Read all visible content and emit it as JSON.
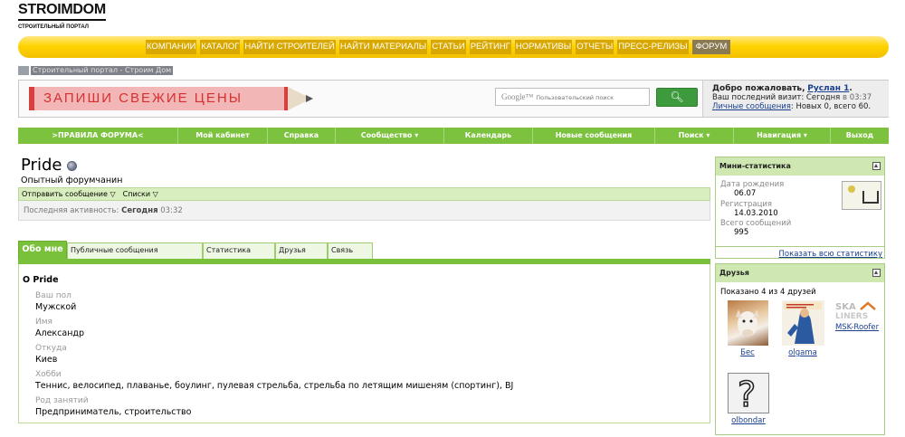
{
  "logo": {
    "title": "STROIMDOM",
    "subtitle": "СТРОИТЕЛЬНЫЙ ПОРТАЛ"
  },
  "topnav": [
    "КОМПАНИИ",
    "КАТАЛОГ",
    "НАЙТИ СТРОИТЕЛЕЙ",
    "НАЙТИ МАТЕРИАЛЫ",
    "СТАТЬИ",
    "РЕЙТИНГ",
    "НОРМАТИВЫ",
    "ОТЧЕТЫ",
    "ПРЕСС-РЕЛИЗЫ",
    "ФОРУМ"
  ],
  "breadcrumb": "Строительный портал - Строим Дом",
  "ad": {
    "text": "ЗАПИШИ СВЕЖИЕ ЦЕНЫ"
  },
  "search": {
    "brand": "Google™",
    "placeholder": "Пользовательский поиск",
    "button_icon": "search-icon"
  },
  "welcome": {
    "greeting": "Добро пожаловать,",
    "username": "Руслан 1",
    "last_visit_label": "Ваш последний визит:",
    "last_visit_day": "Сегодня",
    "last_visit_time": "в 03:37",
    "pm_link": "Личные сообщения",
    "pm_counts": ": Новых 0, всего 60."
  },
  "greennav": [
    ">ПРАВИЛА ФОРУМА<",
    "Мой кабинет",
    "Справка",
    "Сообщество",
    "Календарь",
    "Новые сообщения",
    "Поиск",
    "Навигация",
    "Выход"
  ],
  "profile": {
    "name": "Pride",
    "rank": "Опытный форумчанин",
    "send_message": "Отправить сообщение",
    "lists": "Списки",
    "activity_label": "Последняя активность:",
    "activity_day": "Сегодня",
    "activity_time": "03:32"
  },
  "tabs": [
    "Обо мне",
    "Публичные сообщения",
    "Статистика",
    "Друзья",
    "Связь"
  ],
  "about": {
    "title": "О Pride",
    "fields": [
      {
        "label": "Ваш пол",
        "value": "Мужской"
      },
      {
        "label": "Имя",
        "value": "Александр"
      },
      {
        "label": "Откуда",
        "value": "Киев"
      },
      {
        "label": "Хобби",
        "value": "Теннис, велосипед, плаванье, боулинг, пулевая стрельба, стрельба по летящим мишеням (спортинг), BJ"
      },
      {
        "label": "Род занятий",
        "value": "Предприниматель, строительство"
      }
    ]
  },
  "ministats": {
    "title": "Мини-статистика",
    "birth_label": "Дата рождения",
    "birth_value": "06.07",
    "reg_label": "Регистрация",
    "reg_value": "14.03.2010",
    "posts_label": "Всего сообщений",
    "posts_value": "995",
    "link": "Показать всю статистику"
  },
  "friends": {
    "title": "Друзья",
    "count": "Показано 4 из 4 друзей",
    "list": [
      "Бес",
      "olgama",
      "MSK-Roofer",
      "olbondar"
    ]
  },
  "colors": {
    "accent_green": "#79c13b",
    "nav_yellow": "#ffd400",
    "link_blue": "#1a3f8f"
  }
}
